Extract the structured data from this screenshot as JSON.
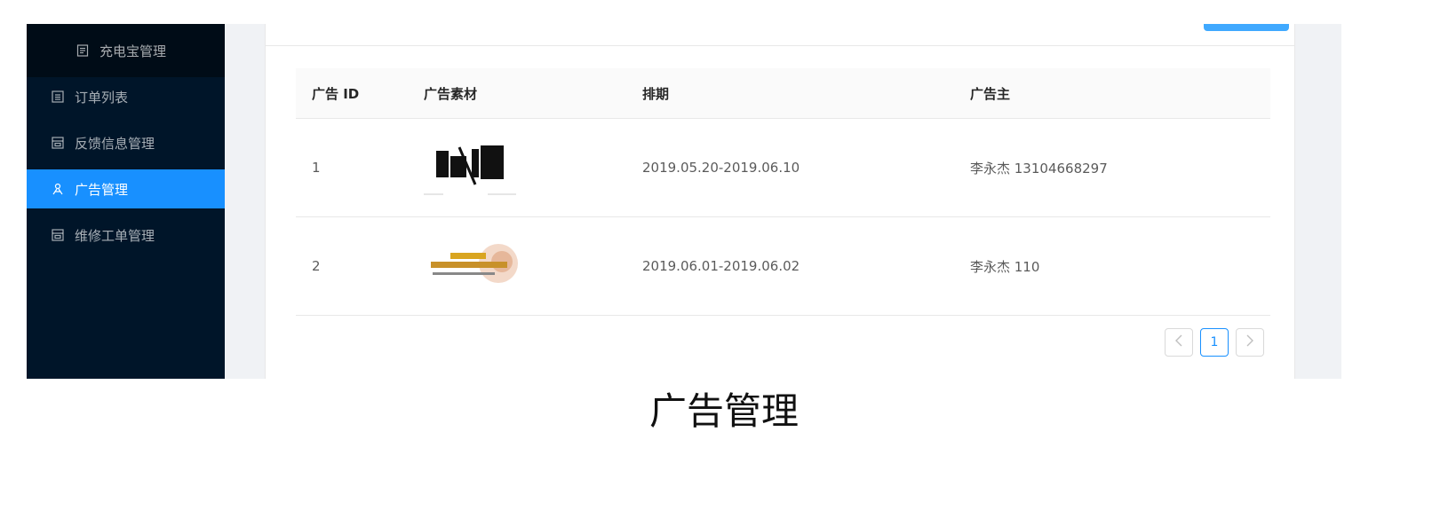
{
  "sidebar": {
    "parent_label": "充电宝管理",
    "items": [
      {
        "label": "订单列表",
        "icon": "list-icon",
        "active": false
      },
      {
        "label": "反馈信息管理",
        "icon": "form-icon",
        "active": false
      },
      {
        "label": "广告管理",
        "icon": "team-icon",
        "active": true
      },
      {
        "label": "维修工单管理",
        "icon": "form-icon",
        "active": false
      }
    ]
  },
  "table": {
    "columns": [
      "广告 ID",
      "广告素材",
      "排期",
      "广告主"
    ],
    "rows": [
      {
        "id": "1",
        "image_icon": "recruit-poster-image",
        "schedule": "2019.05.20-2019.06.10",
        "advertiser": "李永杰 13104668297"
      },
      {
        "id": "2",
        "image_icon": "blog-banner-image",
        "schedule": "2019.06.01-2019.06.02",
        "advertiser": "李永杰 110"
      }
    ]
  },
  "pagination": {
    "prev_icon": "chevron-left-icon",
    "current": "1",
    "next_icon": "chevron-right-icon"
  },
  "caption": "广告管理",
  "colors": {
    "sidebar_bg": "#001529",
    "active_bg": "#1890ff",
    "accent": "#1890ff"
  }
}
